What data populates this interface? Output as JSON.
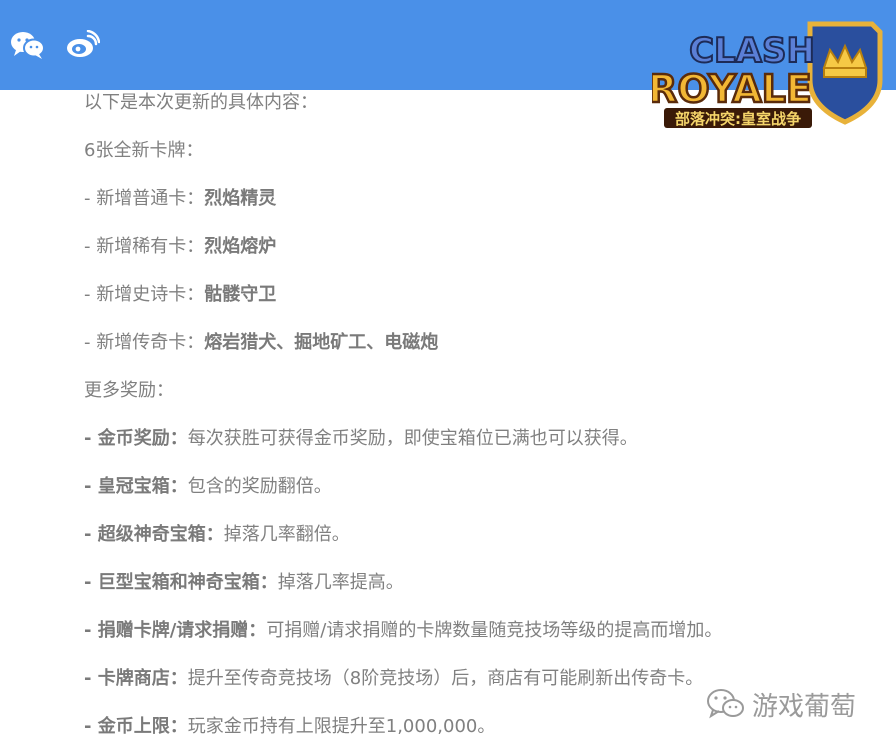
{
  "header": {
    "share_icons": [
      "wechat-icon",
      "weibo-icon"
    ],
    "brand_color": "#4a90e8"
  },
  "logo": {
    "line1": "CLASH",
    "line2": "ROYALE",
    "subtitle": "部落冲突:皇室战争"
  },
  "content": {
    "intro": "以下是本次更新的具体内容：",
    "new_cards_heading": "6张全新卡牌：",
    "cards": [
      {
        "prefix": "- 新增普通卡：",
        "value": "烈焰精灵"
      },
      {
        "prefix": "- 新增稀有卡：",
        "value": "烈焰熔炉"
      },
      {
        "prefix": "- 新增史诗卡：",
        "value": "骷髅守卫"
      },
      {
        "prefix": "- 新增传奇卡：",
        "value": "熔岩猎犬、掘地矿工、电磁炮"
      }
    ],
    "rewards_heading": "更多奖励：",
    "rewards": [
      {
        "label": "- 金币奖励：",
        "text": "每次获胜可获得金币奖励，即使宝箱位已满也可以获得。"
      },
      {
        "label": "- 皇冠宝箱：",
        "text": "包含的奖励翻倍。"
      },
      {
        "label": "- 超级神奇宝箱：",
        "text": "掉落几率翻倍。"
      },
      {
        "label": "- 巨型宝箱和神奇宝箱：",
        "text": "掉落几率提高。"
      },
      {
        "label": "- 捐赠卡牌/请求捐赠：",
        "text": "可捐赠/请求捐赠的卡牌数量随竞技场等级的提高而增加。"
      },
      {
        "label": "- 卡牌商店：",
        "text": "提升至传奇竞技场（8阶竞技场）后，商店有可能刷新出传奇卡。"
      },
      {
        "label": "- 金币上限：",
        "text": "玩家金币持有上限提升至1,000,000。"
      }
    ]
  },
  "watermark": {
    "text": "游戏葡萄"
  }
}
